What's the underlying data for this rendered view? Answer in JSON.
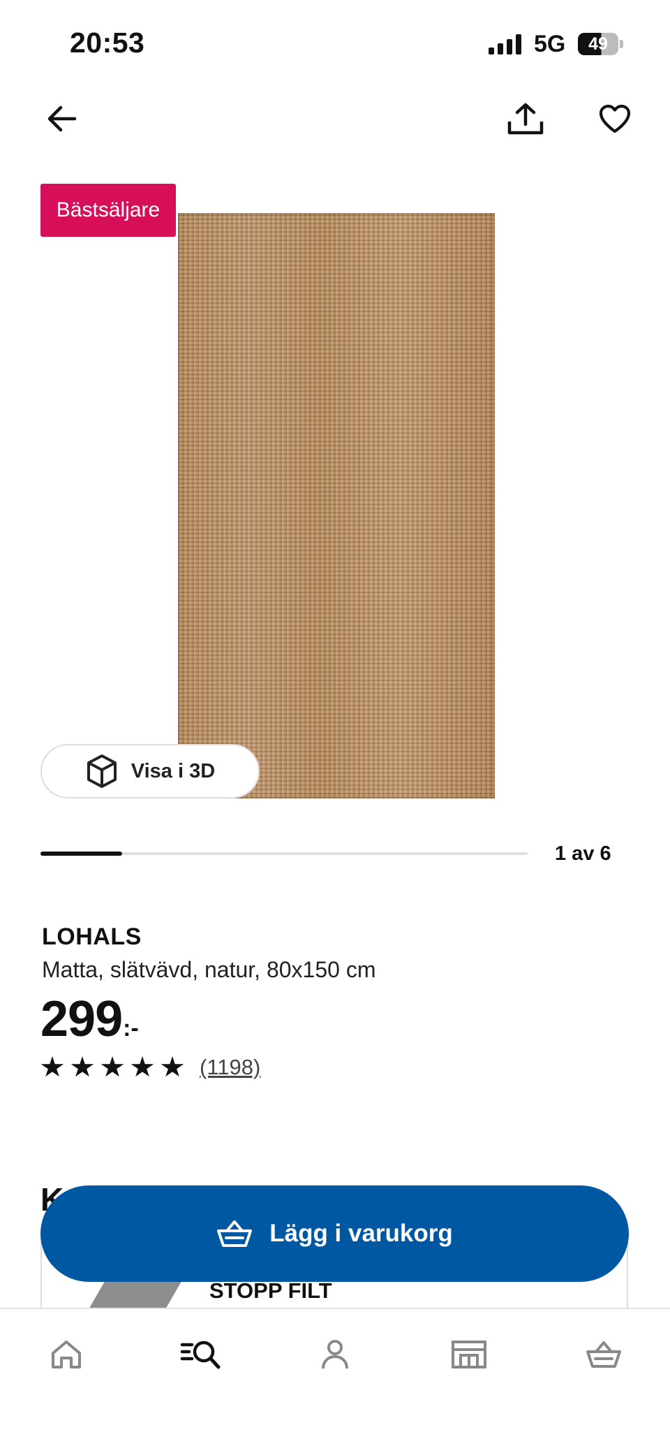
{
  "status_bar": {
    "time": "20:53",
    "network": "5G",
    "battery": "49"
  },
  "top_nav": {
    "back_icon": "arrow-left-icon",
    "share_icon": "share-icon",
    "favorite_icon": "heart-icon"
  },
  "product": {
    "badge": "Bästsäljare",
    "view_3d_label": "Visa i 3D",
    "image_counter": "1 av 6",
    "image_progress": 0.167,
    "name": "LOHALS",
    "description": "Matta, slätvävd, natur, 80x150 cm",
    "price_main": "299",
    "price_suffix": ":-",
    "rating": 5,
    "review_count": "(1198)"
  },
  "related": {
    "section_head_partial": "K",
    "item_title": "STOPP FILT"
  },
  "cart": {
    "label": "Lägg i varukorg"
  },
  "bottom_nav": {
    "items": [
      {
        "icon": "home-icon"
      },
      {
        "icon": "search-icon",
        "active": true
      },
      {
        "icon": "profile-icon"
      },
      {
        "icon": "store-icon"
      },
      {
        "icon": "basket-icon"
      }
    ]
  },
  "colors": {
    "badge": "#d70f58",
    "primary": "#0058a3"
  }
}
